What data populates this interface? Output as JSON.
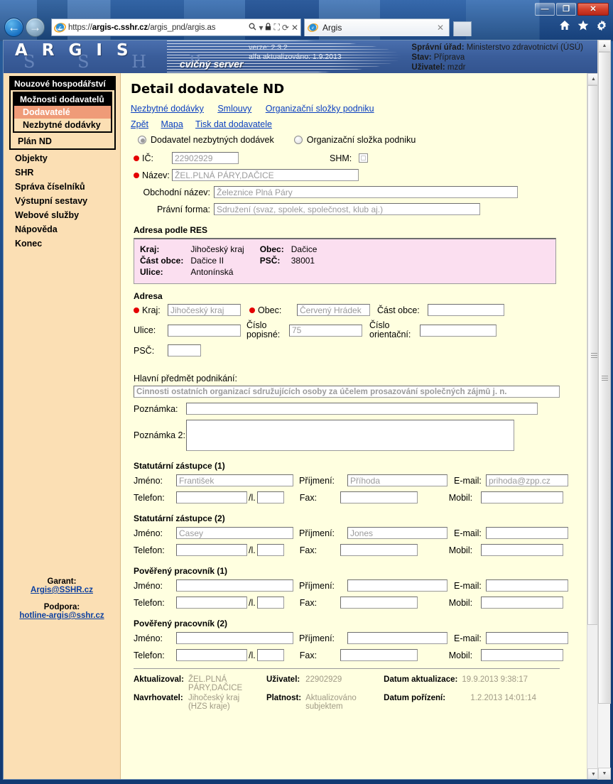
{
  "window": {
    "minimize_label": "—",
    "maximize_label": "❐",
    "close_label": "✕"
  },
  "browser": {
    "back_label": "←",
    "forward_label": "→",
    "url_prefix": "https://",
    "url_host": "argis-c.sshr.cz",
    "url_path": "/argis_pnd/argis.as",
    "search_icon": "search-icon",
    "dropdown_icon": "▾",
    "lock_icon": "🔒",
    "compat_icon": "⛶",
    "refresh_icon": "⟳",
    "stop_icon": "✕",
    "tab_title": "Argis",
    "tab_close_label": "✕",
    "home_icon": "⌂",
    "favorites_icon": "★",
    "tools_icon": "⚙"
  },
  "banner": {
    "logo": "A R G I S",
    "ghost": "S S H R",
    "subtitle": "cvičný server",
    "version_line1": "verze: 2.3.2",
    "version_line2": "alfa aktualizováno: 1.9.2013",
    "office_label": "Správní úřad:",
    "office_value": "Ministerstvo zdravotnictví (ÚSÚ)",
    "state_label": "Stav:",
    "state_value": "Příprava",
    "user_label": "Uživatel:",
    "user_value": "mzdr"
  },
  "sidebar": {
    "menu_header": "Nouzové hospodářství",
    "sub_header": "Možnosti dodavatelů",
    "items": [
      {
        "label": "Dodavatelé",
        "active": true
      },
      {
        "label": "Nezbytné dodávky",
        "active": false
      }
    ],
    "plan_label": "Plán ND",
    "nav": [
      "Objekty",
      "SHR",
      "Správa číselníků",
      "Výstupní sestavy",
      "Webové služby",
      "Nápověda",
      "Konec"
    ],
    "garant_label": "Garant:",
    "garant_email": "Argis@SSHR.cz",
    "podpora_label": "Podpora:",
    "podpora_email": "hotline-argis@sshr.cz"
  },
  "main": {
    "title": "Detail dodavatele ND",
    "tab_links": [
      "Nezbytné dodávky",
      "Smlouvy",
      "Organizační složky podniku"
    ],
    "action_links": [
      "Zpět",
      "Mapa",
      "Tisk dat dodavatele"
    ],
    "radios": [
      {
        "label": "Dodavatel nezbytných dodávek",
        "selected": true
      },
      {
        "label": "Organizační složka podniku",
        "selected": false
      }
    ],
    "ico_label": "IČ:",
    "ico_value": "22902929",
    "shm_label": "SHM:",
    "shm_checked": false,
    "nazev_label": "Název:",
    "nazev_value": "ŽEL.PLNÁ PÁRY,DAČICE",
    "obchodni_label": "Obchodní název:",
    "obchodni_value": "Železnice Plná Páry",
    "pravni_label": "Právní forma:",
    "pravni_value": "Sdružení (svaz, spolek, společnost, klub aj.)",
    "res_title": "Adresa podle RES",
    "res": {
      "kraj_label": "Kraj:",
      "kraj_value": "Jihočeský kraj",
      "obec_label": "Obec:",
      "obec_value": "Dačice",
      "cast_label": "Část obce:",
      "cast_value": "Dačice II",
      "psc_label": "PSČ:",
      "psc_value": "38001",
      "ulice_label": "Ulice:",
      "ulice_value": "Antonínská"
    },
    "adresa_title": "Adresa",
    "adresa": {
      "kraj_label": "Kraj:",
      "kraj_value": "Jihočeský kraj",
      "obec_label": "Obec:",
      "obec_value": "Červený Hrádek",
      "cast_obce_label": "Část obce:",
      "cast_obce_value": "",
      "ulice_label": "Ulice:",
      "ulice_value": "",
      "cislo_popisne_label": "Číslo popisné:",
      "cislo_popisne_value": "75",
      "cislo_orientacni_label": "Číslo orientační:",
      "cislo_orientacni_value": "",
      "psc_label": "PSČ:",
      "psc_value": ""
    },
    "predmet_label": "Hlavní předmět podnikání:",
    "predmet_value": "Činnosti ostatních organizací sdružujících osoby za účelem prosazování společných zájmů j. n.",
    "poznamka_label": "Poznámka:",
    "poznamka_value": "",
    "poznamka2_label": "Poznámka 2:",
    "poznamka2_value": "",
    "person_field_labels": {
      "jmeno": "Jméno:",
      "prijmeni": "Příjmení:",
      "email": "E-mail:",
      "telefon": "Telefon:",
      "linka": "/l.",
      "fax": "Fax:",
      "mobil": "Mobil:"
    },
    "persons": [
      {
        "title": "Statutární zástupce (1)",
        "jmeno": "František",
        "prijmeni": "Příhoda",
        "email": "prihoda@zpp.cz",
        "telefon": "",
        "linka": "",
        "fax": "",
        "mobil": ""
      },
      {
        "title": "Statutární zástupce (2)",
        "jmeno": "Casey",
        "prijmeni": "Jones",
        "email": "",
        "telefon": "",
        "linka": "",
        "fax": "",
        "mobil": ""
      },
      {
        "title": "Pověřený pracovník (1)",
        "jmeno": "",
        "prijmeni": "",
        "email": "",
        "telefon": "",
        "linka": "",
        "fax": "",
        "mobil": ""
      },
      {
        "title": "Pověřený pracovník (2)",
        "jmeno": "",
        "prijmeni": "",
        "email": "",
        "telefon": "",
        "linka": "",
        "fax": "",
        "mobil": ""
      }
    ],
    "footer": {
      "aktualizoval_label": "Aktualizoval:",
      "aktualizoval_value": "ŽEL.PLNÁ PÁRY,DAČICE",
      "uzivatel_label": "Uživatel:",
      "uzivatel_value": "22902929",
      "datum_akt_label": "Datum aktualizace:",
      "datum_akt_value": "19.9.2013 9:38:17",
      "navrhovatel_label": "Navrhovatel:",
      "navrhovatel_value": "Jihočeský kraj (HZS kraje)",
      "platnost_label": "Platnost:",
      "platnost_value": "Aktualizováno subjektem",
      "datum_por_label": "Datum pořízení:",
      "datum_por_value": "1.2.2013 14:01:14"
    }
  }
}
